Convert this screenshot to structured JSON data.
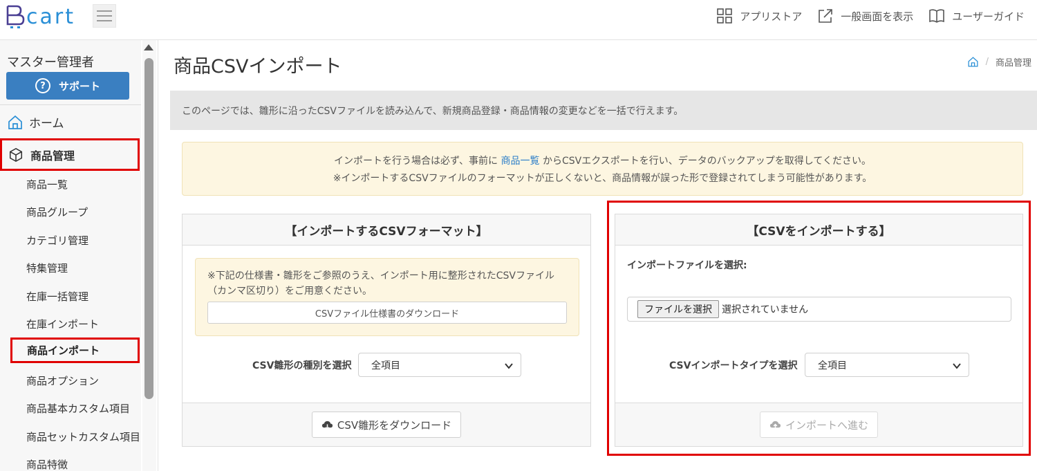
{
  "header": {
    "logo_text": "cart",
    "links": [
      {
        "label": "アプリストア",
        "icon": "grid-icon"
      },
      {
        "label": "一般画面を表示",
        "icon": "external-link-icon"
      },
      {
        "label": "ユーザーガイド",
        "icon": "book-icon"
      }
    ]
  },
  "sidebar": {
    "user": "マスター管理者",
    "support_label": "サポート",
    "home_label": "ホーム",
    "product_label": "商品管理",
    "sub_items": [
      "商品一覧",
      "商品グループ",
      "カテゴリ管理",
      "特集管理",
      "在庫一括管理",
      "在庫インポート",
      "商品インポート",
      "商品オプション",
      "商品基本カスタム項目",
      "商品セットカスタム項目",
      "商品特徴"
    ],
    "active_item": "商品インポート"
  },
  "main": {
    "title": "商品CSVインポート",
    "breadcrumb": {
      "separator": "/",
      "current": "商品管理"
    },
    "info": "このページでは、雛形に沿ったCSVファイルを読み込んで、新規商品登録・商品情報の変更などを一括で行えます。",
    "warning": {
      "line1_pre": "インポートを行う場合は必ず、事前に",
      "line1_link": "商品一覧",
      "line1_post": "からCSVエクスポートを行い、データのバックアップを取得してください。",
      "line2": "※インポートするCSVファイルのフォーマットが正しくないと、商品情報が誤った形で登録されてしまう可能性があります。"
    },
    "format_panel": {
      "heading": "【インポートするCSVフォーマット】",
      "note": "※下記の仕様書・雛形をご参照のうえ、インポート用に整形されたCSVファイル（カンマ区切り）をご用意ください。",
      "spec_button": "CSVファイル仕様書のダウンロード",
      "select_label": "CSV雛形の種別を選択",
      "select_value": "全項目",
      "download_button": "CSV雛形をダウンロード"
    },
    "import_panel": {
      "heading": "【CSVをインポートする】",
      "file_label": "インポートファイルを選択:",
      "file_button": "ファイルを選択",
      "file_status": "選択されていません",
      "type_label": "CSVインポートタイプを選択",
      "type_value": "全項目",
      "next_button": "インポートへ進む"
    }
  },
  "colors": {
    "accent": "#3a7fc1",
    "highlight_red": "#e00000",
    "warning_bg": "#fdf6e1",
    "link": "#2a7dc8"
  }
}
